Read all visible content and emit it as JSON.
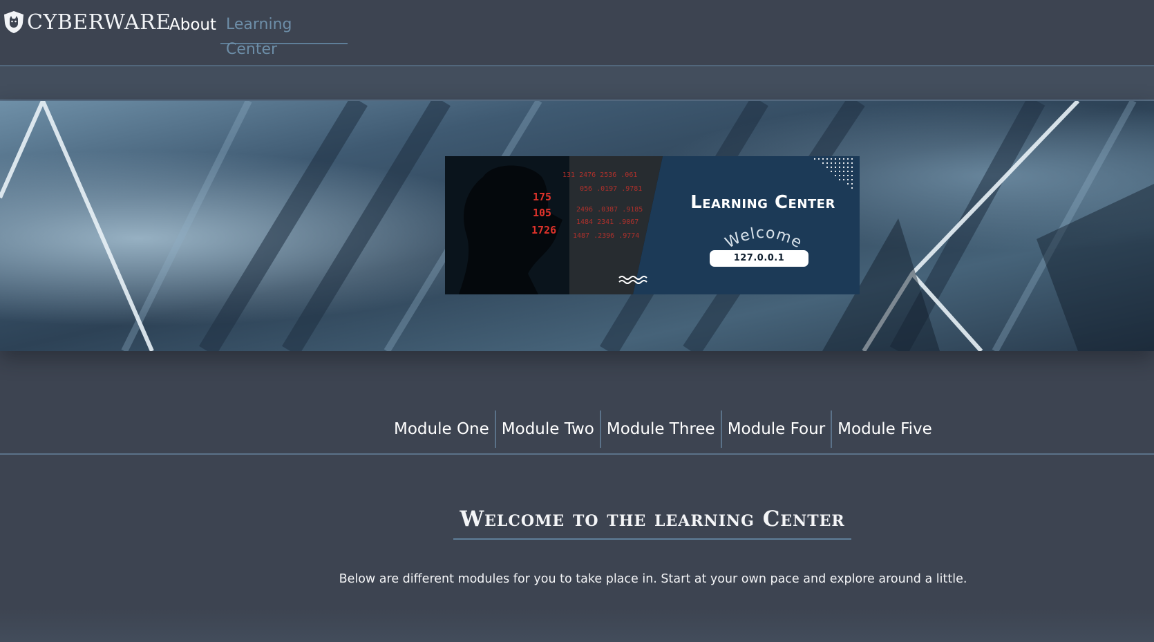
{
  "nav": {
    "brand": "CYBERWARE",
    "about": "About",
    "learning_center": "Learning Center"
  },
  "banner": {
    "title": "Learning Center",
    "welcome": "Welcome",
    "ip": "127.0.0.1",
    "code_lines": [
      "175",
      "105",
      "1726"
    ],
    "code_rows": [
      "131 2476 2536 .061",
      "056 .0197 .9781",
      "2496 .0387 .9185",
      "1484 2341 .9067",
      "1487 .2396 .9774"
    ]
  },
  "modules": [
    "Module One",
    "Module Two",
    "Module Three",
    "Module Four",
    "Module Five"
  ],
  "welcome": {
    "title": "Welcome to the learning Center",
    "text": "Below are different modules for you to take place in. Start at your own pace and explore around a little."
  },
  "colors": {
    "background": "#3d4451",
    "accent": "#5f7f99",
    "banner_navy": "#1c3a57",
    "code_red": "#e0332b"
  },
  "icons": {
    "brand": "shield-cat-icon"
  }
}
